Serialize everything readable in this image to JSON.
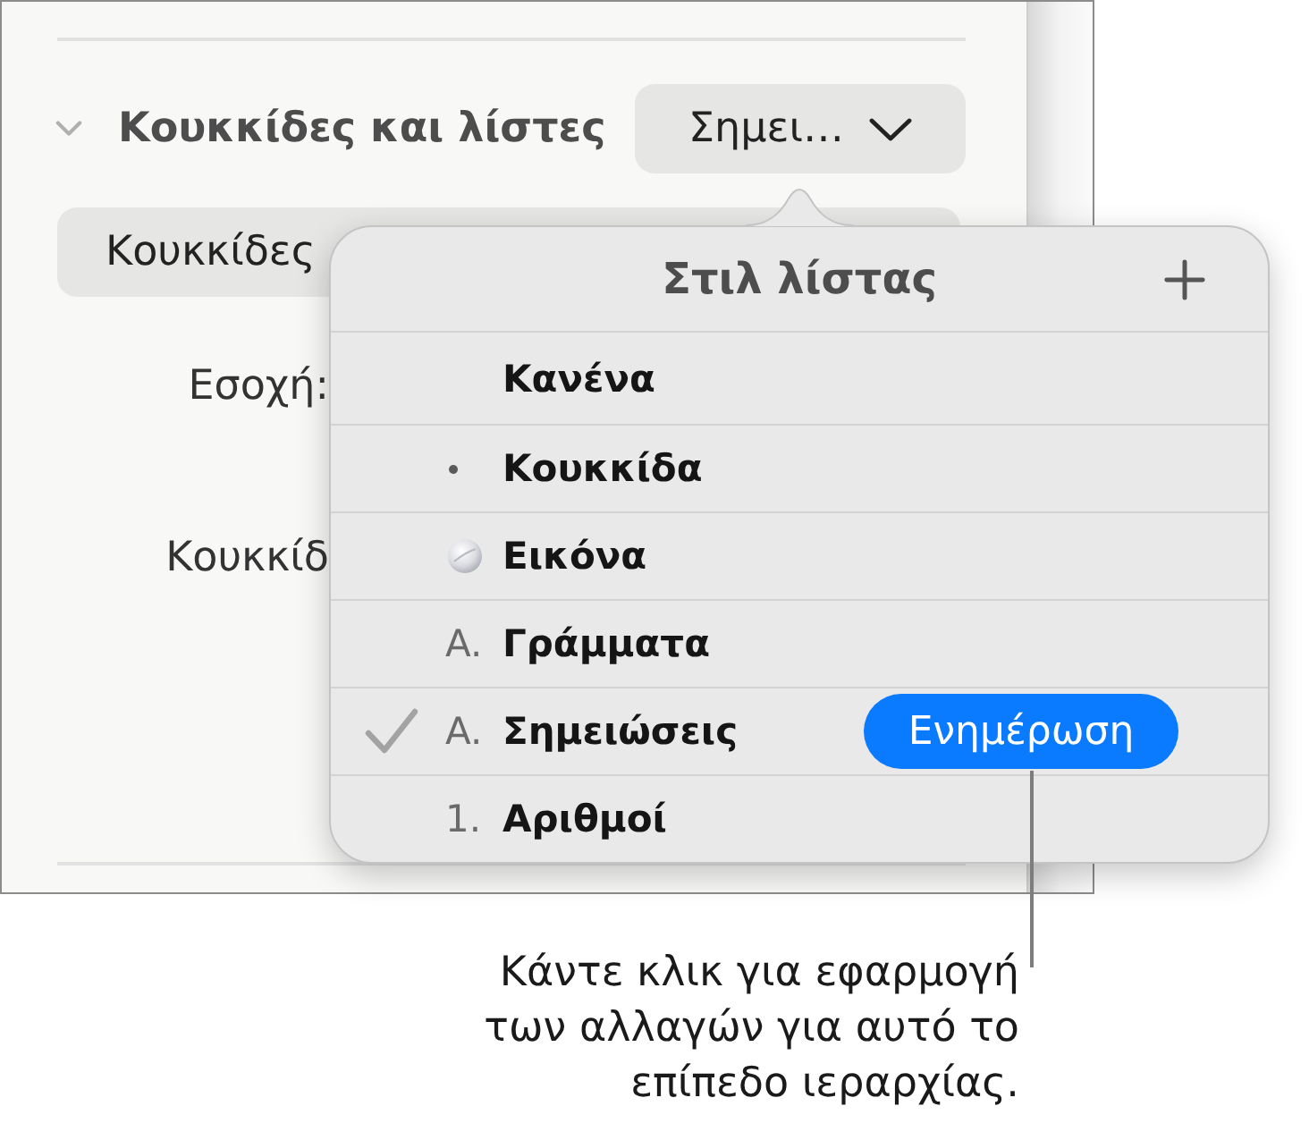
{
  "inspector": {
    "section": {
      "title": "Κουκκίδες και λίστες",
      "expanded": true,
      "style_popup": "Σημει…"
    },
    "type_button": "Κουκκίδες",
    "fields": [
      {
        "label": "Εσοχή:"
      },
      {
        "label": "Κουκκίδ"
      }
    ]
  },
  "popover": {
    "title": "Στιλ λίστας",
    "items": [
      {
        "label": "Κανένα",
        "kind": "none",
        "selected": false
      },
      {
        "label": "Κουκκίδα",
        "kind": "bullet",
        "selected": false
      },
      {
        "label": "Εικόνα",
        "kind": "image",
        "selected": false
      },
      {
        "label": "Γράμματα",
        "kind": "text",
        "marker": "A.",
        "selected": false
      },
      {
        "label": "Σημειώσεις",
        "kind": "text",
        "marker": "A.",
        "selected": true,
        "button": "Ενημέρωση"
      },
      {
        "label": "Αριθμοί",
        "kind": "text",
        "marker": "1.",
        "selected": false
      }
    ]
  },
  "callout": {
    "text": "Κάντε κλικ για εφαρμογή των αλλαγών για αυτό το επίπεδο ιεραρχίας."
  }
}
